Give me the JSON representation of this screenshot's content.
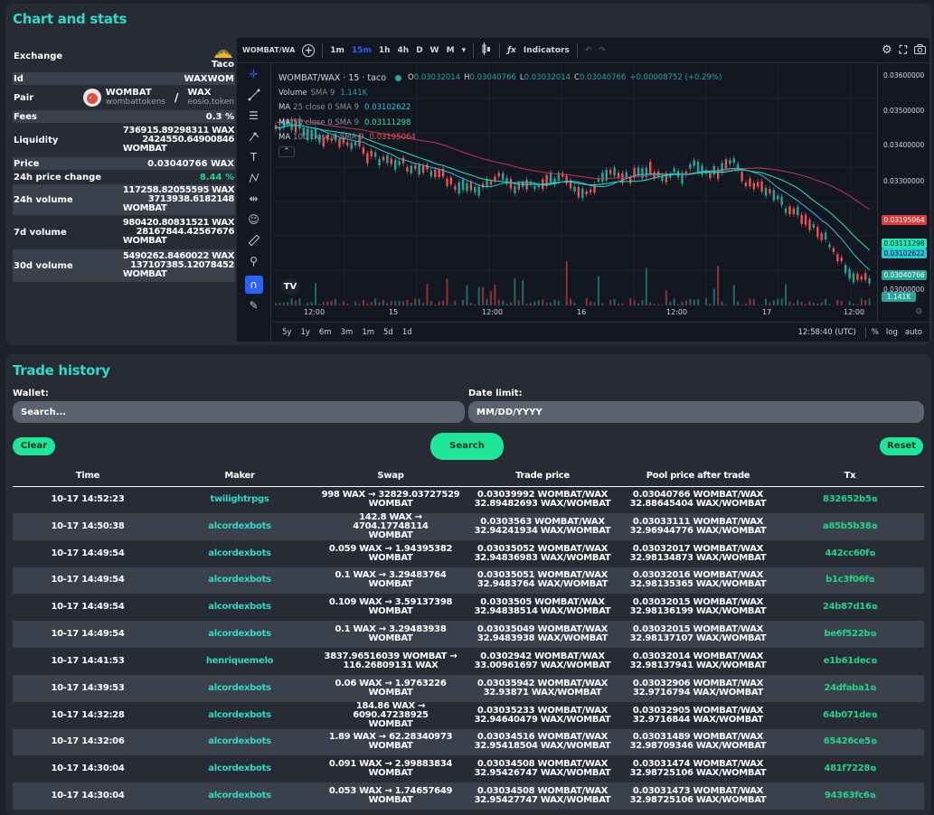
{
  "colors": {
    "accent": "#2fd9c5",
    "green": "#22d38a",
    "button": "#1ee898",
    "panel": "#262b35",
    "chart_bg": "#131722",
    "up": "#26a69a",
    "down": "#ef5350",
    "ma25": "#26c6da",
    "ma50": "#1de9b6",
    "ma100": "#e53935"
  },
  "chart_panel": {
    "title": "Chart and stats"
  },
  "stats": {
    "exchange_label": "Exchange",
    "exchange_value": "Taco",
    "id_label": "Id",
    "id_value": "WAXWOM",
    "pair_label": "Pair",
    "base_symbol": "WOMBAT",
    "base_contract": "wombattokens",
    "separator": "/",
    "quote_symbol": "WAX",
    "quote_contract": "eosio.token",
    "fees_label": "Fees",
    "fees_value": "0.3 %",
    "liquidity_label": "Liquidity",
    "liquidity_1": "736915.89298311 WAX",
    "liquidity_2": "2424550.64900846",
    "liquidity_3": "WOMBAT",
    "price_label": "Price",
    "price_value": "0.03040766 WAX",
    "change_label": "24h price change",
    "change_value": "8.44 %",
    "vol24_label": "24h volume",
    "vol24_1": "117258.82055595 WAX",
    "vol24_2": "3713938.6182148",
    "vol24_3": "WOMBAT",
    "vol7_label": "7d volume",
    "vol7_1": "980420.80831521 WAX",
    "vol7_2": "28167844.42567676",
    "vol7_3": "WOMBAT",
    "vol30_label": "30d volume",
    "vol30_1": "5490262.8460022 WAX",
    "vol30_2": "137107385.12078452",
    "vol30_3": "WOMBAT"
  },
  "toolbar": {
    "symbol": "WOMBAT/WA",
    "intervals": [
      "1m",
      "15m",
      "1h",
      "4h",
      "D",
      "W",
      "M"
    ],
    "indicators": "Indicators"
  },
  "legend": {
    "main": "WOMBAT/WAX · 15 · taco",
    "o_l": "O",
    "o": "0.03032014",
    "h_l": "H",
    "h": "0.03040766",
    "l_l": "L",
    "l": "0.03032014",
    "c_l": "C",
    "c": "0.03040766",
    "chg": "+0.00008752 (+0.29%)",
    "vol_name": "Volume",
    "vol_params": "SMA 9",
    "vol_val": "1.141K",
    "ma1_name": "MA",
    "ma1_params": "25 close 0 SMA 9",
    "ma1_val": "0.03102622",
    "ma2_name": "MA",
    "ma2_params": "50 close 0 SMA 9",
    "ma2_val": "0.03111298",
    "ma3_name": "MA",
    "ma3_params": "100 close 0 SMA 9",
    "ma3_val": "0.03195064"
  },
  "yaxis": {
    "ticks": [
      "0.03600000",
      "0.03500000",
      "0.03400000",
      "0.03300000",
      "0.03000000"
    ],
    "tag_ma100": "0.03195064",
    "tag_ma50": "0.03111298",
    "tag_ma25": "0.03102622",
    "tag_price": "0.03040766",
    "tag_vol": "1.141K"
  },
  "xaxis": {
    "ticks": [
      "12:00",
      "15",
      "12:00",
      "16",
      "12:00",
      "17",
      "12:00"
    ]
  },
  "bottom": {
    "ranges": [
      "5y",
      "1y",
      "6m",
      "3m",
      "1m",
      "5d",
      "1d"
    ],
    "time": "12:58:40 (UTC)",
    "pct": "%",
    "log": "log",
    "auto": "auto"
  },
  "trade_panel": {
    "title": "Trade history",
    "wallet_label": "Wallet:",
    "wallet_placeholder": "Search...",
    "date_label": "Date limit:",
    "date_placeholder": "MM/DD/YYYY",
    "clear": "Clear",
    "search": "Search",
    "reset": "Reset"
  },
  "table": {
    "headers": [
      "Time",
      "Maker",
      "Swap",
      "Trade price",
      "Pool price after trade",
      "Tx"
    ],
    "rows": [
      {
        "time": "10-17 14:52:23",
        "maker": "twilightrpgs",
        "swap1": "998 WAX → 32829.03727529",
        "swap2": "WOMBAT",
        "tp1": "0.03039992 WOMBAT/WAX",
        "tp2": "32.89482693 WAX/WOMBAT",
        "pp1": "0.03040766 WOMBAT/WAX",
        "pp2": "32.88645404 WAX/WOMBAT",
        "tx": "832652b5"
      },
      {
        "time": "10-17 14:50:38",
        "maker": "alcordexbots",
        "swap1": "142.8 WAX → 4704.17748114",
        "swap2": "WOMBAT",
        "tp1": "0.0303563 WOMBAT/WAX",
        "tp2": "32.94241934 WAX/WOMBAT",
        "pp1": "0.03033111 WOMBAT/WAX",
        "pp2": "32.96944776 WAX/WOMBAT",
        "tx": "a85b5b38"
      },
      {
        "time": "10-17 14:49:54",
        "maker": "alcordexbots",
        "swap1": "0.059 WAX → 1.94395382 WOMBAT",
        "swap2": "",
        "tp1": "0.03035052 WOMBAT/WAX",
        "tp2": "32.94836983 WAX/WOMBAT",
        "pp1": "0.03032017 WOMBAT/WAX",
        "pp2": "32.98134873 WAX/WOMBAT",
        "tx": "442cc60f"
      },
      {
        "time": "10-17 14:49:54",
        "maker": "alcordexbots",
        "swap1": "0.1 WAX → 3.29483764 WOMBAT",
        "swap2": "",
        "tp1": "0.03035051 WOMBAT/WAX",
        "tp2": "32.9483764 WAX/WOMBAT",
        "pp1": "0.03032016 WOMBAT/WAX",
        "pp2": "32.98135365 WAX/WOMBAT",
        "tx": "b1c3f06f"
      },
      {
        "time": "10-17 14:49:54",
        "maker": "alcordexbots",
        "swap1": "0.109 WAX → 3.59137398 WOMBAT",
        "swap2": "",
        "tp1": "0.0303505 WOMBAT/WAX",
        "tp2": "32.94838514 WAX/WOMBAT",
        "pp1": "0.03032015 WOMBAT/WAX",
        "pp2": "32.98136199 WAX/WOMBAT",
        "tx": "24b87d16"
      },
      {
        "time": "10-17 14:49:54",
        "maker": "alcordexbots",
        "swap1": "0.1 WAX → 3.29483938 WOMBAT",
        "swap2": "",
        "tp1": "0.03035049 WOMBAT/WAX",
        "tp2": "32.9483938 WAX/WOMBAT",
        "pp1": "0.03032015 WOMBAT/WAX",
        "pp2": "32.98137107 WAX/WOMBAT",
        "tx": "be6f522b"
      },
      {
        "time": "10-17 14:41:53",
        "maker": "henriquemelo",
        "swap1": "3837.96516039 WOMBAT →",
        "swap2": "116.26809131 WAX",
        "tp1": "0.0302942 WOMBAT/WAX",
        "tp2": "33.00961697 WAX/WOMBAT",
        "pp1": "0.03032014 WOMBAT/WAX",
        "pp2": "32.98137941 WAX/WOMBAT",
        "tx": "e1b61dec"
      },
      {
        "time": "10-17 14:39:53",
        "maker": "alcordexbots",
        "swap1": "0.06 WAX → 1.9763226 WOMBAT",
        "swap2": "",
        "tp1": "0.03035942 WOMBAT/WAX",
        "tp2": "32.93871 WAX/WOMBAT",
        "pp1": "0.03032906 WOMBAT/WAX",
        "pp2": "32.9716794 WAX/WOMBAT",
        "tx": "24dfaba1"
      },
      {
        "time": "10-17 14:32:28",
        "maker": "alcordexbots",
        "swap1": "184.86 WAX → 6090.47238925",
        "swap2": "WOMBAT",
        "tp1": "0.03035233 WOMBAT/WAX",
        "tp2": "32.94640479 WAX/WOMBAT",
        "pp1": "0.03032905 WOMBAT/WAX",
        "pp2": "32.9716844 WAX/WOMBAT",
        "tx": "64b071de"
      },
      {
        "time": "10-17 14:32:06",
        "maker": "alcordexbots",
        "swap1": "1.89 WAX → 62.28340973 WOMBAT",
        "swap2": "",
        "tp1": "0.03034516 WOMBAT/WAX",
        "tp2": "32.95418504 WAX/WOMBAT",
        "pp1": "0.03031489 WOMBAT/WAX",
        "pp2": "32.98709346 WAX/WOMBAT",
        "tx": "65426ce5"
      },
      {
        "time": "10-17 14:30:04",
        "maker": "alcordexbots",
        "swap1": "0.091 WAX → 2.99883834 WOMBAT",
        "swap2": "",
        "tp1": "0.03034508 WOMBAT/WAX",
        "tp2": "32.95426747 WAX/WOMBAT",
        "pp1": "0.03031474 WOMBAT/WAX",
        "pp2": "32.98725106 WAX/WOMBAT",
        "tx": "481f7228"
      },
      {
        "time": "10-17 14:30:04",
        "maker": "alcordexbots",
        "swap1": "0.053 WAX → 1.74657649 WOMBAT",
        "swap2": "",
        "tp1": "0.03034508 WOMBAT/WAX",
        "tp2": "32.95427747 WAX/WOMBAT",
        "pp1": "0.03031473 WOMBAT/WAX",
        "pp2": "32.98725106 WAX/WOMBAT",
        "tx": "94363fc6"
      }
    ]
  }
}
